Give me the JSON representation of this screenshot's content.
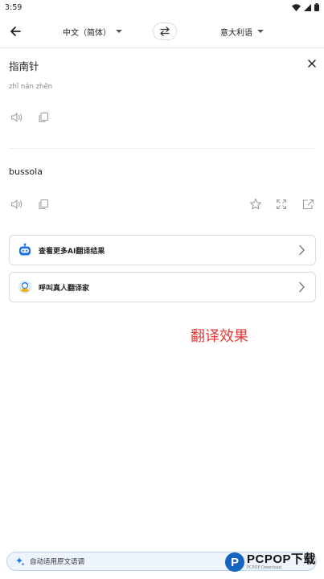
{
  "status_bar": {
    "time": "3:59"
  },
  "header": {
    "source_language": "中文（简体）",
    "target_language": "意大利语"
  },
  "source": {
    "text": "指南针",
    "pinyin": "zhǐ nán zhēn"
  },
  "target": {
    "text": "bussola"
  },
  "cards": [
    {
      "label": "查看更多AI翻译结果",
      "icon": "robot-icon"
    },
    {
      "label": "呼叫真人翻译家",
      "icon": "translator-avatar-icon"
    }
  ],
  "annotation": "翻译效果",
  "bottom_bar": {
    "label": "自动适用原文语调"
  },
  "watermark": {
    "main": "PCPOP下载",
    "sub": "PCPOP Download"
  },
  "colors": {
    "annotation": "#e53935",
    "accent": "#1a73e8",
    "pill_bg": "#eef4fc"
  }
}
